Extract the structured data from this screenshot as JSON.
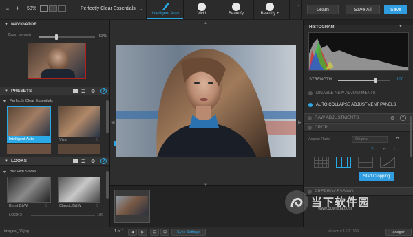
{
  "toolbar": {
    "zoom": "53%",
    "preset_name": "Perfectly Clear Essentials",
    "tabs": [
      {
        "label": "Intelligent Auto",
        "active": true
      },
      {
        "label": "Vivid",
        "active": false
      },
      {
        "label": "Beautify",
        "active": false
      },
      {
        "label": "Beautify +",
        "active": false
      }
    ],
    "learn": "Learn",
    "save_all": "Save All",
    "save": "Save"
  },
  "navigator": {
    "title": "NAVIGATOR",
    "zoom_label": "Zoom percent",
    "zoom_value": "53%",
    "zoom_fraction": 0.53
  },
  "presets": {
    "title": "PRESETS",
    "group": "Perfectly Clear Essentials",
    "items": [
      {
        "label": "Intelligent Auto",
        "selected": true
      },
      {
        "label": "Vivid",
        "selected": false
      }
    ]
  },
  "looks": {
    "title": "LOOKS",
    "group": "BW Film Stocks",
    "items": [
      {
        "label": "Burnt B&W"
      },
      {
        "label": "Classic B&W"
      }
    ],
    "slider_label": "LOOKS",
    "slider_value": "100"
  },
  "histogram": {
    "title": "HISTOGRAM",
    "strength_label": "STRENGTH",
    "strength_value": "100",
    "strength_fraction": 0.72
  },
  "options": {
    "disable": "DISABLE NEW ADJUSTMENTS",
    "collapse": "AUTO COLLAPSE ADJUSTMENT PANELS"
  },
  "sections": {
    "raw": "RAW ADJUSTMENTS",
    "crop": "CROP",
    "aspect_label": "Aspect Ratio",
    "aspect_value": "Original",
    "start_cropping": "Start Cropping",
    "preprocessing": "PREPROCESSING"
  },
  "bottom": {
    "filename": "images_06.jpg",
    "page": "1 of 1",
    "sync": "Sync Settings",
    "version": "Version v.3.6.7.1169",
    "manager": "anager"
  },
  "watermark": {
    "text": "当下软件园",
    "sub": "www.downxia.com"
  },
  "colors": {
    "accent": "#2aa9e6",
    "save_button": "#2f9de0"
  }
}
